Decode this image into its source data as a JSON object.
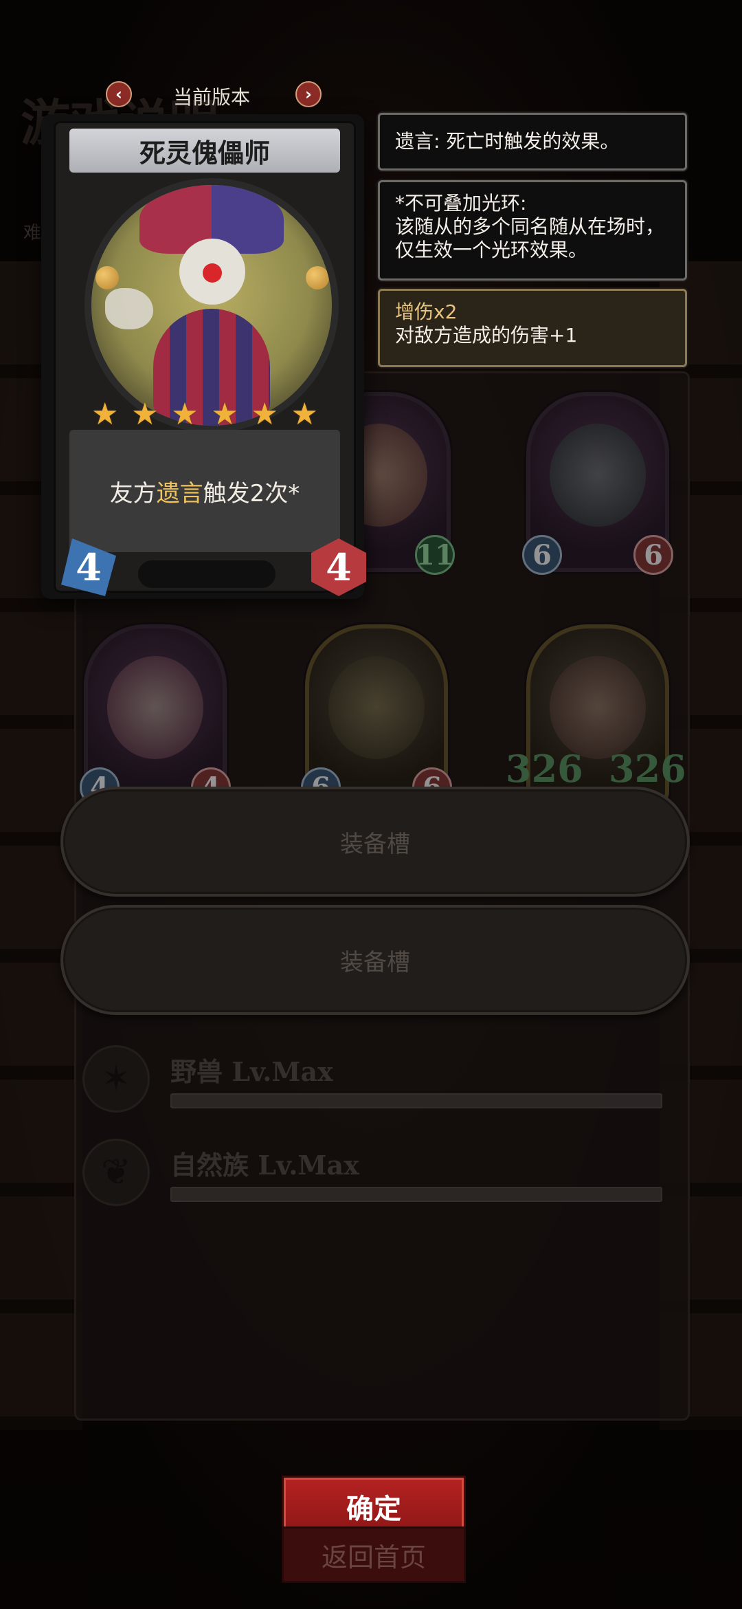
{
  "background": {
    "title": "游戏说明",
    "difficulty_label": "难"
  },
  "version": {
    "label": "当前版本"
  },
  "card": {
    "name": "死灵傀儡师",
    "stars": 6,
    "text_prefix": "友方",
    "text_keyword": "遗言",
    "text_suffix": "触发2次*",
    "attack": "4",
    "health": "4"
  },
  "tooltips": [
    {
      "text": "遗言: 死亡时触发的效果。"
    },
    {
      "line1": "*不可叠加光环:",
      "line2": "该随从的多个同名随从在场时，仅生效一个光环效果。"
    },
    {
      "title": "增伤x2",
      "text": "对敌方造成的伤害+1"
    }
  ],
  "board_minions": [
    {
      "attack": "",
      "health": "11"
    },
    {
      "attack": "6",
      "health": "6"
    },
    {
      "attack": "4",
      "health": "4"
    },
    {
      "attack": "6",
      "health": "6"
    },
    {
      "attack": "326",
      "health": "326"
    }
  ],
  "equipment_slots": [
    {
      "label": "装备槽"
    },
    {
      "label": "装备槽"
    }
  ],
  "races": [
    {
      "name": "野兽 Lv.Max",
      "icon": "claw-icon"
    },
    {
      "name": "自然族 Lv.Max",
      "icon": "nature-icon"
    }
  ],
  "buttons": {
    "confirm": "确定",
    "home": "返回首页"
  },
  "colors": {
    "accent_red": "#b52222",
    "keyword_gold": "#f0c35b",
    "star_gold": "#f0b23a"
  }
}
